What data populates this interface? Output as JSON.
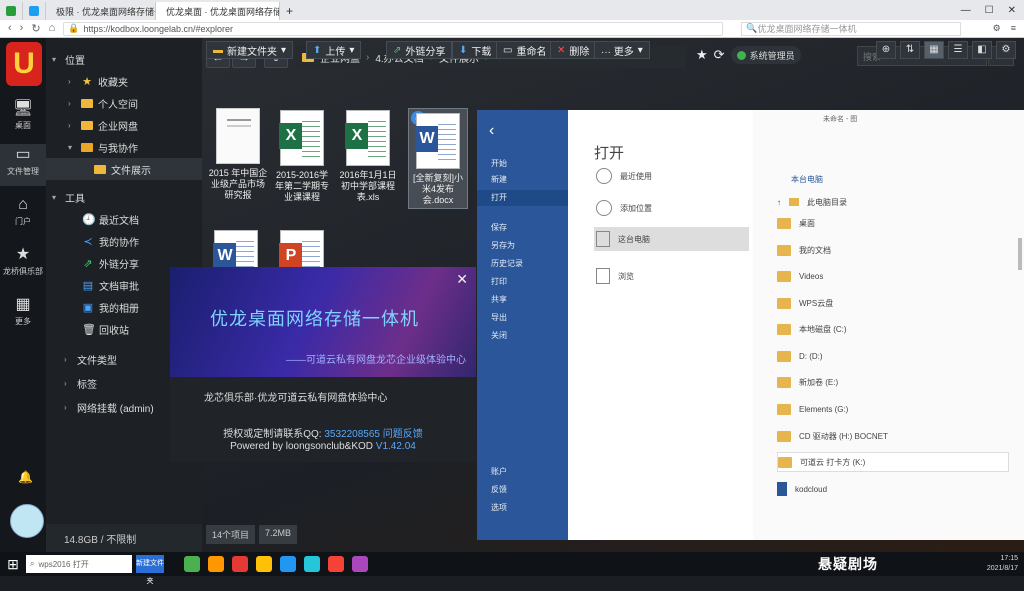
{
  "browser": {
    "tabs": [
      {
        "label": "",
        "color": "#2a9d3b"
      },
      {
        "label": "",
        "color": "#1aa0f2"
      },
      {
        "label": "极限 · 优龙桌面网络存储一体机",
        "color": "#2b6fd6"
      },
      {
        "label": "优龙桌面 · 优龙桌面网络存储一体机",
        "color": "#2b6fd6"
      }
    ],
    "new_tab": "+",
    "url": "https://kodbox.loongelab.cn/#explorer",
    "search_placeholder": "优龙桌面网络存储一体机",
    "window_controls": [
      "—",
      "☐",
      "✕"
    ]
  },
  "rail": {
    "logo": "U",
    "items": [
      {
        "label": "桌面",
        "icon": "🖥"
      },
      {
        "label": "文件管理",
        "icon": "▭"
      },
      {
        "label": "门户",
        "icon": "⌂"
      },
      {
        "label": "龙桥俱乐部",
        "icon": "★"
      },
      {
        "label": "更多",
        "icon": "▦"
      }
    ]
  },
  "tree": {
    "items": [
      {
        "label": "位置",
        "depth": 0,
        "type": "header"
      },
      {
        "label": "收藏夹",
        "depth": 1,
        "type": "star"
      },
      {
        "label": "个人空间",
        "depth": 1,
        "type": "folder"
      },
      {
        "label": "企业网盘",
        "depth": 1,
        "type": "folder"
      },
      {
        "label": "与我协作",
        "depth": 1,
        "type": "folder"
      },
      {
        "label": "文件展示",
        "depth": 2,
        "type": "folder"
      },
      {
        "label": "工具",
        "depth": 0,
        "type": "header"
      },
      {
        "label": "最近文档",
        "depth": 1,
        "type": "clock"
      },
      {
        "label": "我的协作",
        "depth": 1,
        "type": "share"
      },
      {
        "label": "外链分享",
        "depth": 1,
        "type": "link"
      },
      {
        "label": "文档审批",
        "depth": 1,
        "type": "doc"
      },
      {
        "label": "我的相册",
        "depth": 1,
        "type": "photo"
      },
      {
        "label": "回收站",
        "depth": 1,
        "type": "trash"
      },
      {
        "label": "文件类型",
        "depth": 0,
        "type": "header"
      },
      {
        "label": "标签",
        "depth": 0,
        "type": "header"
      },
      {
        "label": "网络挂载 (admin)",
        "depth": 0,
        "type": "header"
      }
    ],
    "storage": "14.8GB / 不限制"
  },
  "toolbar": {
    "breadcrumbs": [
      "企业网盘",
      "4.办公文档",
      "文件展示"
    ],
    "admin_label": "系统管理员",
    "search_placeholder": "搜索",
    "new_folder": "新建文件夹",
    "upload": "上传",
    "share": "外链分享",
    "download": "下载",
    "rename": "重命名",
    "delete": "删除",
    "more": "··· 更多"
  },
  "files": [
    {
      "name": "2015 年中国企业级产品市场研究报",
      "kind": "doc"
    },
    {
      "name": "2015-2016学年第二学期专业课课程",
      "kind": "xls"
    },
    {
      "name": "2016年1月1日初中学部课程表.xls",
      "kind": "xls"
    },
    {
      "name": "[全新复刻]小米4发布会.docx",
      "kind": "word"
    },
    {
      "name": "",
      "kind": "word"
    },
    {
      "name": "",
      "kind": "ppt"
    }
  ],
  "about": {
    "title": "优龙桌面网络存储一体机",
    "tagline": "——可道云私有网盘龙芯企业级体验中心",
    "line1": "龙芯俱乐部·优龙可道云私有网盘体验中心",
    "contact_label": "授权或定制请联系QQ:",
    "contact_qq": "3532208565",
    "contact_link": "问题反馈",
    "powered": "Powered by loongsonclub&KOD",
    "version": "V1.42.04",
    "close": "✕"
  },
  "status": {
    "count": "14个项目",
    "size": "7.2MB"
  },
  "word_open": {
    "top_note": "未命名 - 图",
    "side": [
      "开始",
      "新建",
      "打开",
      "保存",
      "另存为",
      "历史记录",
      "打印",
      "共享",
      "导出",
      "关闭",
      "账户",
      "反馈",
      "选项"
    ],
    "heading": "打开",
    "options": [
      "最近使用",
      "添加位置",
      "这台电脑",
      "浏览"
    ],
    "location_heading": "本台电脑",
    "rows": [
      "此电脑目录",
      "桌面",
      "我的文档",
      "Videos",
      "WPS云盘",
      "本地磁盘 (C:)",
      "D: (D:)",
      "新加卷 (E:)",
      "Elements (G:)",
      "CD 驱动器 (H:) BOCNET",
      "可道云 打卡方 (K:)",
      "kodcloud"
    ]
  },
  "taskbar": {
    "search_text": "wps2016 打开",
    "active_app": "新建文件夹",
    "brand": "悬疑剧场",
    "time": "17:15",
    "date": "2021/8/17",
    "icon_colors": [
      "#4caf50",
      "#ff9800",
      "#e53935",
      "#ffc107",
      "#2196f3",
      "#26c6da",
      "#f44336",
      "#ab47bc"
    ]
  }
}
